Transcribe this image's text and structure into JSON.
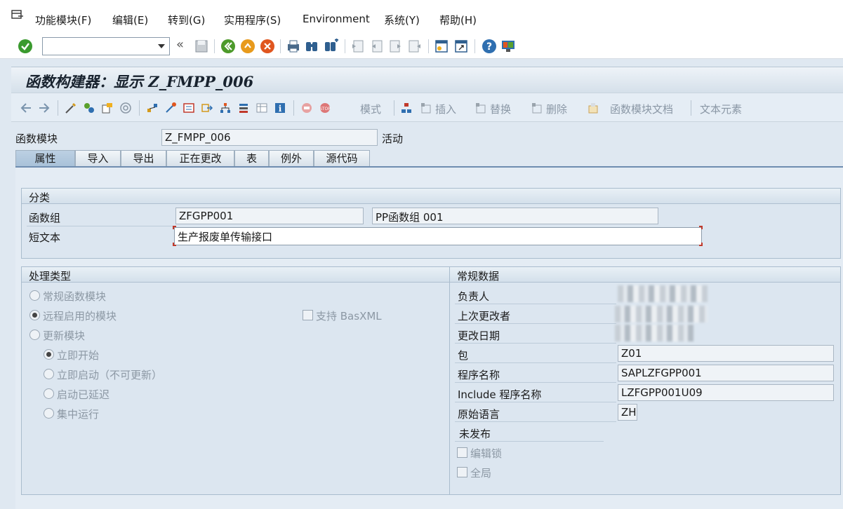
{
  "menu": {
    "items": [
      "功能模块(F)",
      "编辑(E)",
      "转到(G)",
      "实用程序(S)",
      "Environment",
      "系统(Y)",
      "帮助(H)"
    ]
  },
  "toolbar": {
    "command_value": "",
    "icons": [
      "enter-icon",
      "dropdown-icon",
      "back-double-icon",
      "save-icon",
      "back-icon",
      "exit-icon",
      "cancel-icon",
      "print-icon",
      "find-icon",
      "find-next-icon",
      "first-page-icon",
      "prev-page-icon",
      "next-page-icon",
      "last-page-icon",
      "new-session-icon",
      "shortcut-icon",
      "help-icon",
      "customize-icon"
    ]
  },
  "title": "函数构建器：显示 Z_FMPP_006",
  "app_toolbar": {
    "mode_label": "模式",
    "insert_label": "插入",
    "replace_label": "替换",
    "delete_label": "删除",
    "doc_label": "函数模块文档",
    "text_elements_label": "文本元素"
  },
  "header": {
    "fm_label": "函数模块",
    "fm_value": "Z_FMPP_006",
    "status": "活动"
  },
  "tabs": [
    {
      "label": "属性",
      "active": true
    },
    {
      "label": "导入",
      "active": false
    },
    {
      "label": "导出",
      "active": false
    },
    {
      "label": "正在更改",
      "active": false
    },
    {
      "label": "表",
      "active": false
    },
    {
      "label": "例外",
      "active": false
    },
    {
      "label": "源代码",
      "active": false
    }
  ],
  "classification": {
    "title": "分类",
    "fg_label": "函数组",
    "fg_value": "ZFGPP001",
    "fg_desc": "PP函数组 001",
    "short_text_label": "短文本",
    "short_text_value": "生产报废单传输接口"
  },
  "processing": {
    "title": "处理类型",
    "normal": "常规函数模块",
    "remote": "远程启用的模块",
    "basxml": "支持 BasXML",
    "update": "更新模块",
    "start_immediate": "立即开始",
    "immediate_no_update": "立即启动（不可更新）",
    "delayed": "启动已延迟",
    "collective": "集中运行",
    "selected": "远程启用的模块",
    "update_selected": "立即开始"
  },
  "general": {
    "title": "常规数据",
    "responsible_label": "负责人",
    "last_changed_by_label": "上次更改者",
    "changed_on_label": "更改日期",
    "package_label": "包",
    "package_value": "Z01",
    "program_label": "程序名称",
    "program_value": "SAPLZFGPP001",
    "include_label": "Include 程序名称",
    "include_value": "LZFGPP001U09",
    "language_label": "原始语言",
    "language_value": "ZH",
    "not_released": "未发布",
    "edit_lock": "编辑锁",
    "global": "全局"
  },
  "colors": {
    "background": "#dfe8f1",
    "tab_active": "#a8c1d8",
    "group_head": "#d4e0eb",
    "enter_icon": "#3a9a2e",
    "accent_red": "#c0392b"
  }
}
